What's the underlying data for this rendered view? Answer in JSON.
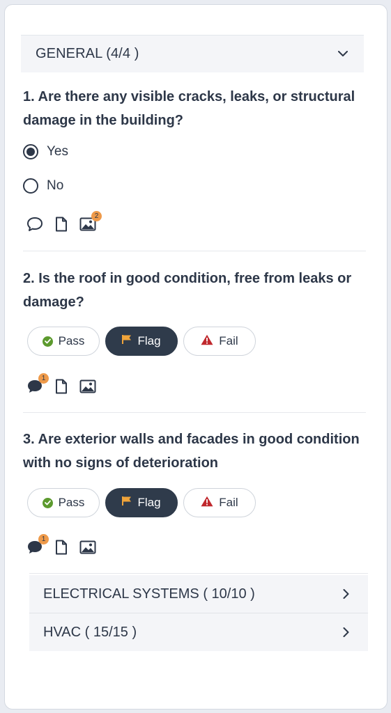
{
  "sections": {
    "general": {
      "title": "GENERAL (4/4 )"
    },
    "electrical": {
      "title": "ELECTRICAL SYSTEMS ( 10/10 )"
    },
    "hvac": {
      "title": "HVAC ( 15/15 )"
    }
  },
  "questions": [
    {
      "text": "1. Are there any visible cracks, leaks, or structural damage in the building?",
      "options": [
        {
          "label": "Yes",
          "selected": true
        },
        {
          "label": "No",
          "selected": false
        }
      ],
      "icons": {
        "comment": "comment-icon",
        "note": "file-icon",
        "image": "image-icon",
        "image_badge": "2"
      }
    },
    {
      "text": "2. Is the roof in good condition, free from leaks or damage?",
      "buttons": {
        "pass": "Pass",
        "flag": "Flag",
        "fail": "Fail"
      },
      "selected": "Flag",
      "icons": {
        "comment": "comment-icon",
        "note": "file-icon",
        "image": "image-icon",
        "comment_badge": "1"
      }
    },
    {
      "text": "3. Are exterior walls and facades in good condition with no signs of deterioration",
      "buttons": {
        "pass": "Pass",
        "flag": "Flag",
        "fail": "Fail"
      },
      "selected": "Flag",
      "icons": {
        "comment": "comment-icon",
        "note": "file-icon",
        "image": "image-icon",
        "comment_badge": "1"
      }
    }
  ],
  "colors": {
    "dark": "#2f3b4b",
    "pass": "#5c9a2e",
    "flag": "#f0a43a",
    "fail": "#c0282d",
    "badge": "#ee9a4a"
  }
}
